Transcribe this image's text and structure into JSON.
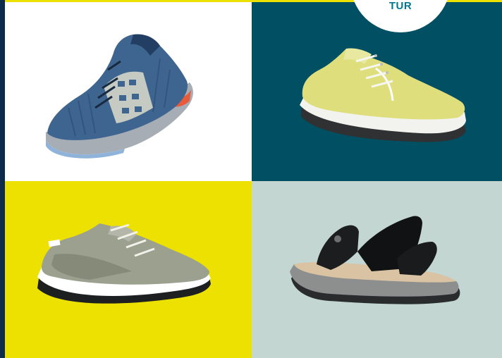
{
  "badge": {
    "text": "TUR"
  },
  "colors": {
    "tile_1_bg": "#ffffff",
    "tile_2_bg": "#004f62",
    "tile_3_bg": "#ece100",
    "tile_4_bg": "#c3d6d2",
    "frame": "#0d2b4a",
    "badge_text": "#00768f"
  },
  "products": [
    {
      "icon": "blue-knit-sneaker-icon"
    },
    {
      "icon": "yellow-suede-sneaker-icon"
    },
    {
      "icon": "grey-running-sneaker-icon"
    },
    {
      "icon": "black-strap-sandal-icon"
    }
  ]
}
